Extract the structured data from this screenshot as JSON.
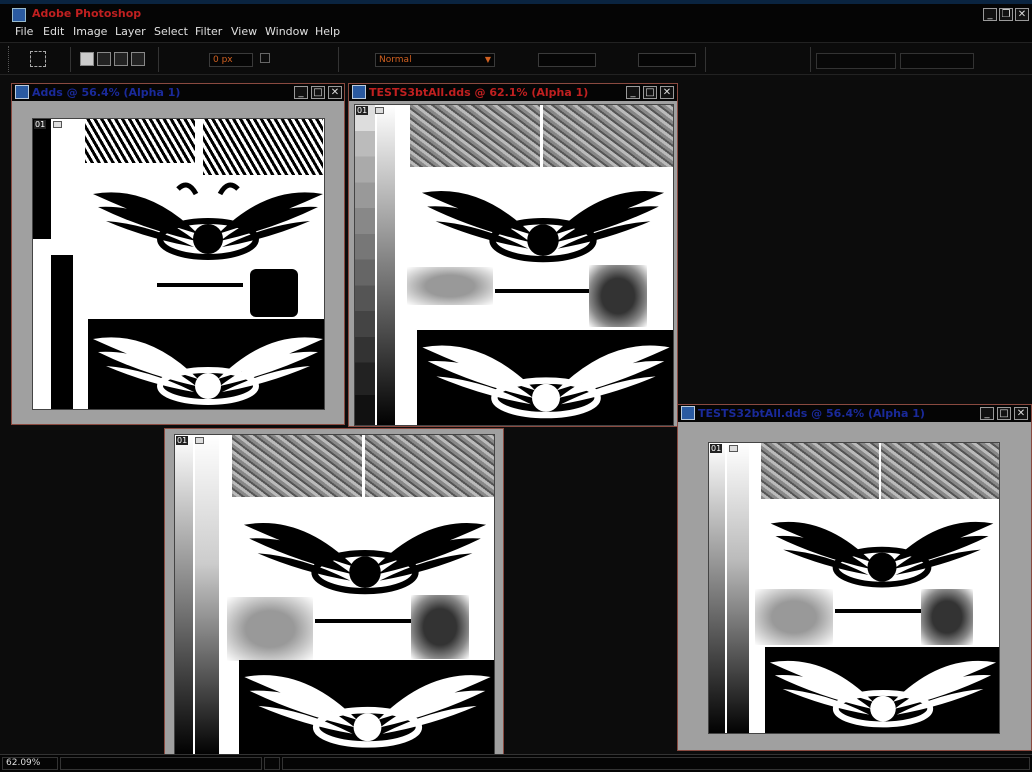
{
  "app": {
    "title": "Adobe Photoshop",
    "controls": [
      "_",
      "❐",
      "✕"
    ]
  },
  "menu": [
    {
      "label": "File"
    },
    {
      "label": "Edit"
    },
    {
      "label": "Image"
    },
    {
      "label": "Layer"
    },
    {
      "label": "Select"
    },
    {
      "label": "Filter"
    },
    {
      "label": "View"
    },
    {
      "label": "Window"
    },
    {
      "label": "Help"
    }
  ],
  "options": {
    "feather_value": "0 px",
    "mode_value": "Normal"
  },
  "documents": [
    {
      "title": "Adds @ 56.4% (Alpha 1)",
      "title_color": "#1a2a9a"
    },
    {
      "title": "TESTS3btAll.dds @ 62.1% (Alpha 1)",
      "title_color": "#c02020"
    },
    {
      "title": "TESTS32btAll.dds @ 56.4% (Alpha 1)",
      "title_color": "#1a2a9a"
    }
  ],
  "channel_tag": "01",
  "window_controls": [
    "_",
    "□",
    "✕"
  ],
  "status": {
    "zoom": "62.09%"
  },
  "colors": {
    "accent": "#c02020",
    "inactive_title": "#1a2a9a",
    "field_text": "#d06020"
  }
}
